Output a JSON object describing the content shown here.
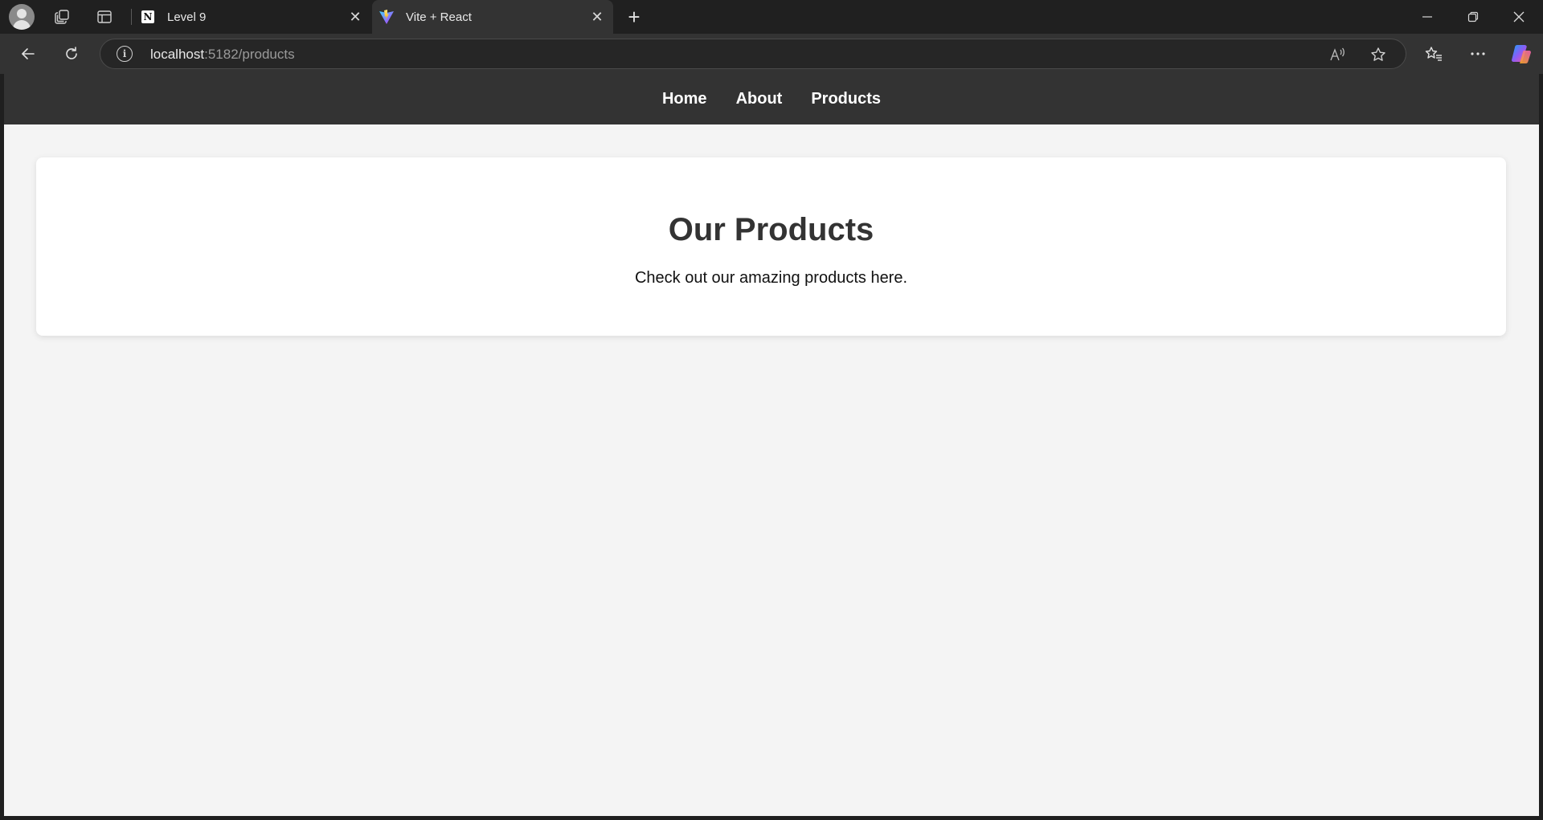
{
  "browser": {
    "tabs": [
      {
        "title": "Level 9",
        "favicon": "notion-icon",
        "active": false
      },
      {
        "title": "Vite + React",
        "favicon": "vite-icon",
        "active": true
      }
    ],
    "address_bar": {
      "host": "localhost",
      "path": ":5182/products"
    }
  },
  "page": {
    "nav": {
      "home": "Home",
      "about": "About",
      "products": "Products"
    },
    "heading": "Our Products",
    "description": "Check out our amazing products here."
  },
  "colors": {
    "navbar_bg": "#333333",
    "page_bg": "#f4f4f4",
    "card_bg": "#ffffff",
    "heading": "#333333"
  }
}
